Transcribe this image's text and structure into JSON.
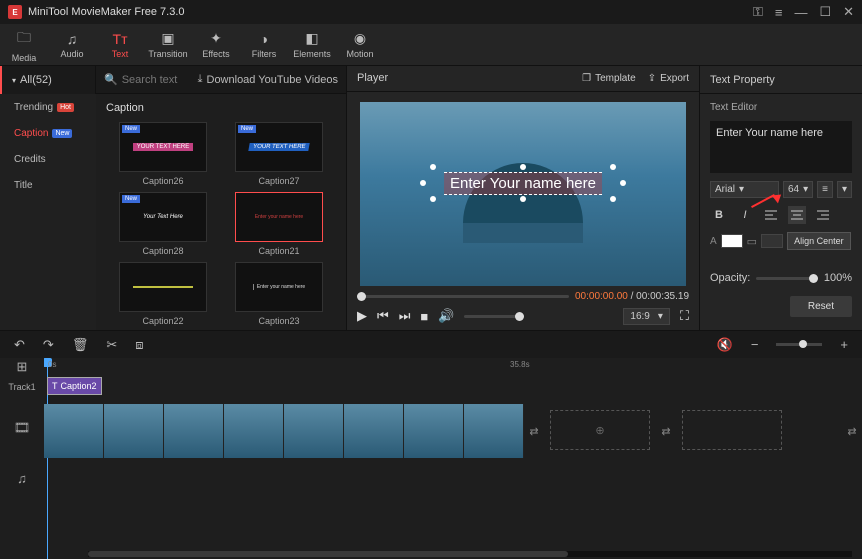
{
  "app": {
    "title": "MiniTool MovieMaker Free 7.3.0"
  },
  "toolbar": {
    "media": "Media",
    "audio": "Audio",
    "text": "Text",
    "transition": "Transition",
    "effects": "Effects",
    "filters": "Filters",
    "elements": "Elements",
    "motion": "Motion"
  },
  "sidebar": {
    "all": "All(52)",
    "items": [
      {
        "label": "Trending",
        "badge": "Hot"
      },
      {
        "label": "Caption",
        "badge": "New"
      },
      {
        "label": "Credits"
      },
      {
        "label": "Title"
      }
    ]
  },
  "browser": {
    "search_placeholder": "Search text",
    "download": "Download YouTube Videos",
    "section": "Caption",
    "thumbs": [
      {
        "name": "Caption26",
        "new": true,
        "inner": "YOUR TEXT HERE"
      },
      {
        "name": "Caption27",
        "new": true,
        "inner": "YOUR TEXT HERE"
      },
      {
        "name": "Caption28",
        "new": true,
        "inner": "Your Text Here"
      },
      {
        "name": "Caption21",
        "selected": true,
        "inner": "Enter your name here"
      },
      {
        "name": "Caption22",
        "inner": ""
      },
      {
        "name": "Caption23",
        "inner": "Enter your name here"
      }
    ]
  },
  "player": {
    "title": "Player",
    "template": "Template",
    "export": "Export",
    "overlay_text": "Enter Your name here",
    "time_current": "00:00:00.00",
    "time_total": "00:00:35.19",
    "aspect": "16:9"
  },
  "textprop": {
    "title": "Text Property",
    "editor_label": "Text Editor",
    "editor_value": "Enter Your name here",
    "font": "Arial",
    "size": "64",
    "tooltip": "Align Center",
    "opacity_label": "Opacity:",
    "opacity_value": "100%",
    "reset": "Reset"
  },
  "timeline": {
    "ruler0": "0s",
    "rulerMid": "35.8s",
    "track1": "Track1",
    "text_clip": "Caption2"
  }
}
